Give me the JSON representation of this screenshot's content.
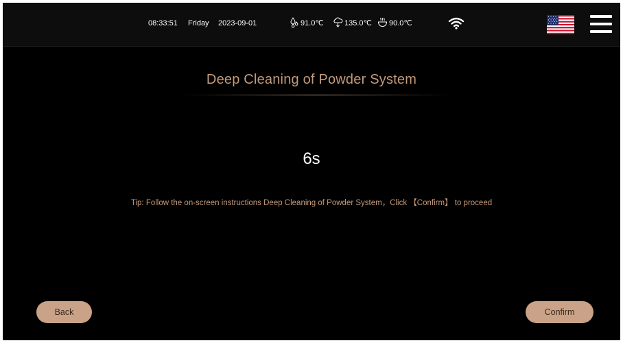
{
  "status_bar": {
    "time": "08:33:51",
    "day": "Friday",
    "date": "2023-09-01",
    "temps": [
      {
        "icon": "water-drop-icon",
        "value": "91.0℃"
      },
      {
        "icon": "steam-icon",
        "value": "135.0℃"
      },
      {
        "icon": "milk-heat-icon",
        "value": "90.0℃"
      }
    ],
    "wifi_icon": "wifi-icon",
    "language_flag": "us-flag-icon",
    "menu_icon": "hamburger-menu-icon"
  },
  "main": {
    "title": "Deep Cleaning of Powder System",
    "countdown": "6s",
    "tip": "Tip: Follow the on-screen instructions Deep Cleaning of Powder System，Click 【Confirm】 to proceed"
  },
  "buttons": {
    "back": "Back",
    "confirm": "Confirm"
  },
  "colors": {
    "background": "#000000",
    "accent": "#c49a7a",
    "button": "#c9a287"
  }
}
